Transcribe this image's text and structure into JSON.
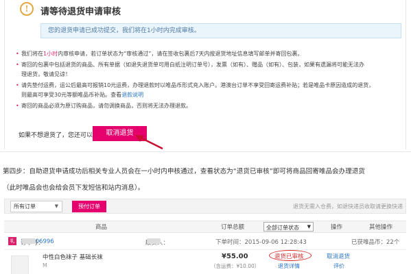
{
  "panel": {
    "info_icon": "!",
    "title": "请等待退货申请审核",
    "notice": "您的退货申请已成功提交，我们将在1小时内完成审核。",
    "bullets": {
      "b1_pre": "我们将在",
      "b1_hl": "1小时",
      "b1_post": "内审核申请，若订单状态为“审核通过”，请在签收包裹后7天内按退货地址信息填写邮单并寄回包裹。",
      "b2a": "寄回的包裹中包括退货的商品、所有单据（如退失退货单可用白纸注明订单号），发票（如有）、赠品（如有）、包装，如果有遗漏将可能无法办",
      "b2b": "理退货，敬请见谅！",
      "b3a": "请先垫付运费，运公后最高可报销10元运费，办理退款时以唯品币形式充入账户。港澳台订单不享受回寄运费补贴；若是唯品卡原因造成的退货，",
      "b3b_pre": "则最高可享受30元等额唯品币补贴。查看",
      "b3b_link": "退款说明",
      "b4": "寄回的商品必须为原订购商品，请勿调换商品，否则将无法办理退款。"
    },
    "no_return_text": "如果不想退货了，您还可以",
    "cancel_button": "取消退货"
  },
  "step": {
    "line1": "第四步：自助退货申请成功后相关专业人员会在一小时内申核通过，查看状态为“退货已审核”即可将商品回寄唯品会办理退货",
    "line2": "（此时唯品会也会给会员下发短信和站内消息）。"
  },
  "orders": {
    "filter_select": "所有订单",
    "prepay_button": "预付订单",
    "filter_hint": "退货无需入仓费，如退快递员收取请更换快递",
    "headers": {
      "product": "商品",
      "total": "订单总额",
      "status_select": "全部订单状态",
      "action": "操作",
      "other": "其他操作"
    },
    "order": {
      "gift_icon": "礼",
      "order_no_label": "订单号：",
      "order_no": "150906996",
      "receiver_label": "收货人：",
      "receiver_value": "严",
      "time": "下单时间：2015-09-06 12:28:43",
      "points": "已获唯品币：22个",
      "product_name": "中性白色袜子 基础长袜",
      "product_size": "M",
      "price": "¥55.00",
      "price_sub": "（含运费：¥10.00）",
      "status": "退货已审核",
      "status_detail": "退货详情",
      "cancel_link": "取消退货",
      "review_link": "评价"
    }
  },
  "colors": {
    "brand_pink": "#e5006d",
    "highlight_red": "#d12a2a",
    "link_blue": "#2b76c4",
    "notice_blue_bg": "#eaf4fb",
    "info_orange": "#e4a640"
  }
}
